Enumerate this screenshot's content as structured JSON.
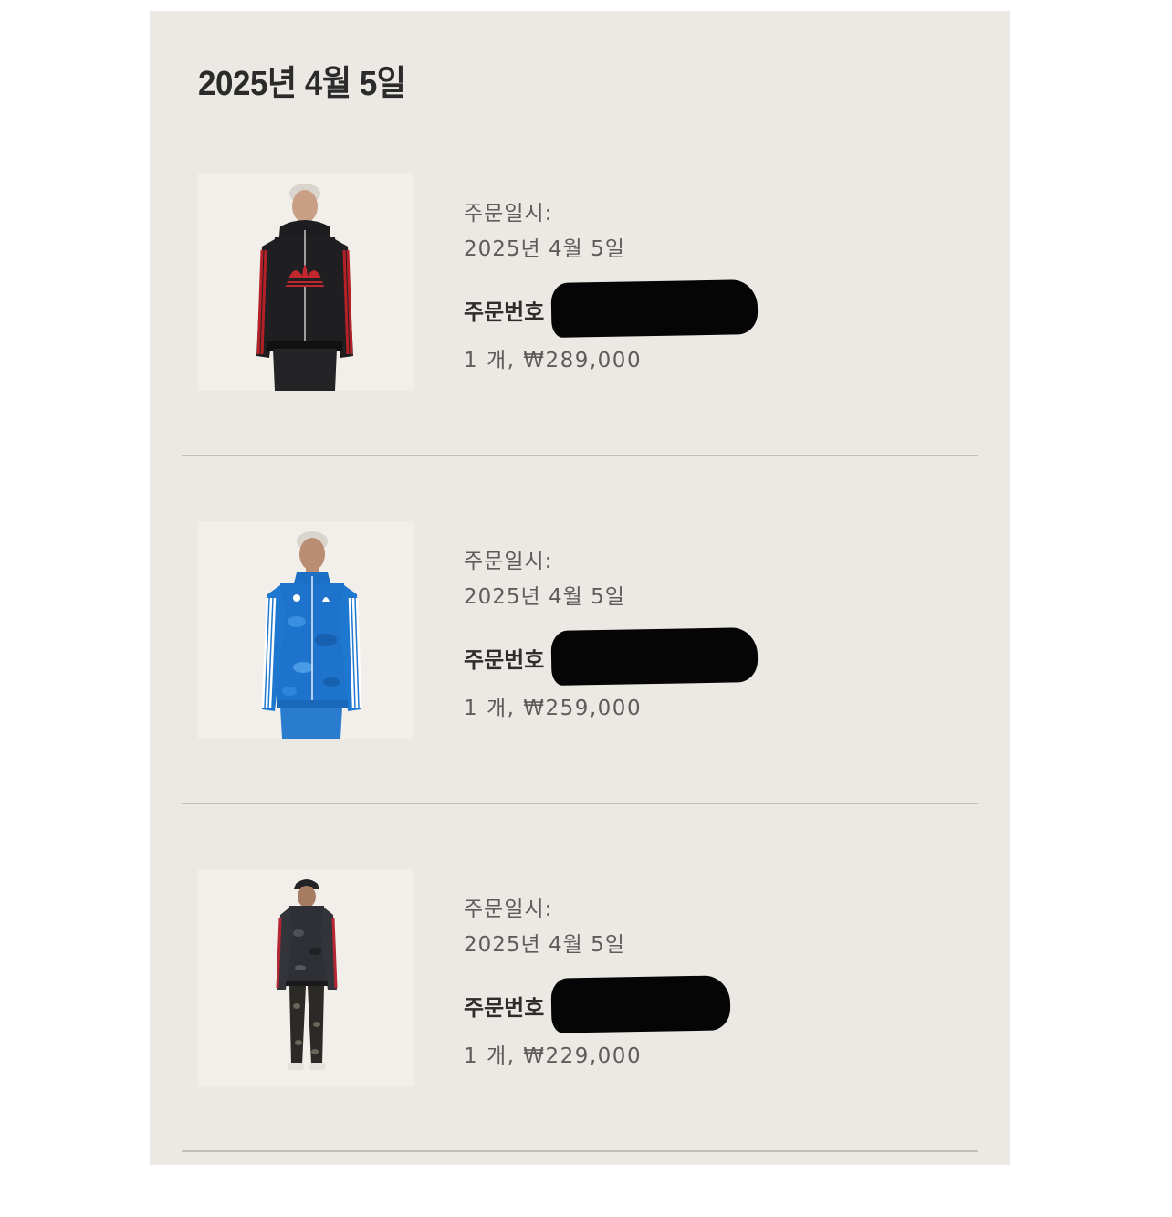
{
  "page": {
    "title": "2025년 4월 5일"
  },
  "orders": [
    {
      "date_label": "주문일시:",
      "date_value": "2025년 4월 5일",
      "order_number_label": "주문번호",
      "quantity_price": "1 개, ₩289,000",
      "image_icon": "product-image-black-red-hooded-track-jacket"
    },
    {
      "date_label": "주문일시:",
      "date_value": "2025년 4월 5일",
      "order_number_label": "주문번호",
      "quantity_price": "1 개, ₩259,000",
      "image_icon": "product-image-blue-camo-track-jacket"
    },
    {
      "date_label": "주문일시:",
      "date_value": "2025년 4월 5일",
      "order_number_label": "주문번호",
      "quantity_price": "1 개, ₩229,000",
      "image_icon": "product-image-black-camo-tracksuit"
    }
  ],
  "colors": {
    "panel_background": "#ece9e5",
    "thumb_background": "#f2efeb",
    "text_primary": "#2e2d2b",
    "text_secondary": "#5f5d5a",
    "divider": "#c2bfbb",
    "redaction": "#050505"
  }
}
